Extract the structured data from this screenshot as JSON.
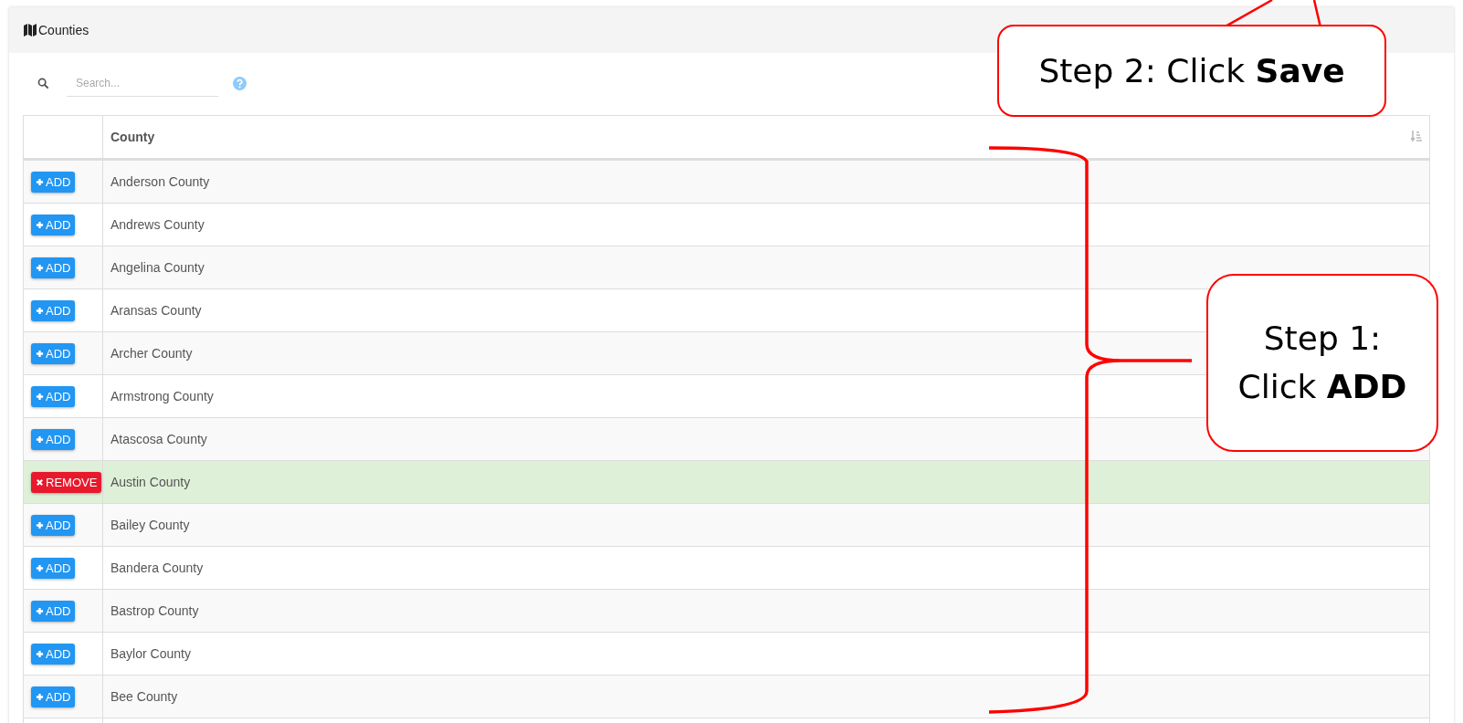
{
  "panel": {
    "title": "Counties"
  },
  "search": {
    "placeholder": "Search..."
  },
  "table": {
    "columns": [
      "County"
    ],
    "rows": [
      {
        "name": "Anderson County",
        "added": false,
        "button": "ADD"
      },
      {
        "name": "Andrews County",
        "added": false,
        "button": "ADD"
      },
      {
        "name": "Angelina County",
        "added": false,
        "button": "ADD"
      },
      {
        "name": "Aransas County",
        "added": false,
        "button": "ADD"
      },
      {
        "name": "Archer County",
        "added": false,
        "button": "ADD"
      },
      {
        "name": "Armstrong County",
        "added": false,
        "button": "ADD"
      },
      {
        "name": "Atascosa County",
        "added": false,
        "button": "ADD"
      },
      {
        "name": "Austin County",
        "added": true,
        "button": "REMOVE"
      },
      {
        "name": "Bailey County",
        "added": false,
        "button": "ADD"
      },
      {
        "name": "Bandera County",
        "added": false,
        "button": "ADD"
      },
      {
        "name": "Bastrop County",
        "added": false,
        "button": "ADD"
      },
      {
        "name": "Baylor County",
        "added": false,
        "button": "ADD"
      },
      {
        "name": "Bee County",
        "added": false,
        "button": "ADD"
      }
    ]
  },
  "callouts": [
    {
      "kind": "top",
      "text": "Step 2: Click **Save**"
    },
    {
      "kind": "side",
      "text": "Step 1: Click **ADD**"
    }
  ]
}
